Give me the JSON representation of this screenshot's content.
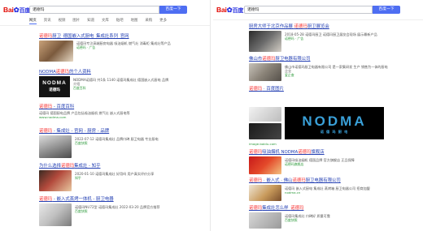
{
  "left": {
    "logo_b": "Bai",
    "logo_du": "百度",
    "query": "诺德玛",
    "search_button": "百度一下",
    "tabs": [
      "网页",
      "资讯",
      "视频",
      "图片",
      "知道",
      "文库",
      "贴吧",
      "地图",
      "采购",
      "更多"
    ],
    "results": [
      {
        "title": "诺德玛厨卫_德国嵌入式厨电_集成灶系列_官网",
        "snippet": "诺德玛专注高端厨房电器 吸油烟机 燃气灶 消毒柜 集成灶等产品",
        "meta": "诺德玛 · 广告"
      },
      {
        "title": "NODMA诺德玛的个人资料",
        "snippet": "NODMA诺德玛 共1条 1140 诺德玛集成灶 德国嵌入式厨电 品牌介绍",
        "meta": "百度百科"
      },
      {
        "title": "诺德玛 - 百度百科",
        "snippet": "诺德玛 德国厨电品牌 产品包括吸油烟机 燃气灶 嵌入式厨电等",
        "meta": "www.nodma.com"
      },
      {
        "title": "诺德玛 - 集成灶 - 官网 - 厨房 - 品牌",
        "snippet": "2022-07-12 诺德玛集成灶 品牌口碑 厨卫电器 专业厨电",
        "meta": "百度快照"
      },
      {
        "title": "为什么选择诺德玛集成灶 - 知乎",
        "snippet": "2020-01-10 诺德玛集成灶 好用吗 用户真实评价分享",
        "meta": "知乎"
      },
      {
        "title": "诺德玛 - 嵌入式蒸烤一体机 - 厨卫电器",
        "snippet": "诺德玛NU72型 诺德玛集成灶 2022-03-20 品牌官方推荐",
        "meta": "百度快照"
      }
    ],
    "nodma_logo": "NODMA",
    "nodma_sub": "诺德玛"
  },
  "right": {
    "logo_b": "Bai",
    "logo_du": "百度",
    "query": "诺德玛",
    "search_button": "百度一下",
    "results": [
      {
        "title": "厨房大师于北京作品展 诺德玛厨卫展览会",
        "snippet": "2018-05-28 诺德玛厨卫 诺德玛厨卫展览会现场 展示最新产品",
        "meta": "诺德玛 · 广告"
      },
      {
        "title": "佛山市诺德玛厨卫电器有限公司",
        "snippet": "佛山市诺德玛厨卫电器有限公司 是一家集研发 生产 销售为一体的厨电企业",
        "meta": "爱企查"
      },
      {
        "title": "诺德玛 · 百度图片",
        "snippet": "",
        "meta": "image.baidu.com"
      },
      {
        "title": "诺德玛吸油烟机 NODMA诺德玛旗舰店",
        "snippet": "诺德玛吸油烟机 德国品牌 官方旗舰店 正品保障",
        "meta": "诺德玛旗舰店"
      },
      {
        "title": "诺德玛 · 嵌入式 · 佛山诺德玛厨卫电器有限公司",
        "snippet": "诺德玛 嵌入式厨电 集成灶 蒸烤箱 厨卫电器公司 招商加盟",
        "meta": "nodma.cn"
      },
      {
        "title": "诺德玛集成灶怎么样_诺德玛",
        "snippet": "诺德玛集成灶 口碑好 质量可靠",
        "meta": "百度快照"
      }
    ],
    "nodma_logo": "NODMA",
    "nodma_sub": "诺 德 玛 厨 电"
  },
  "colors": {
    "accent": "#4e6ef2",
    "link": "#2440b3",
    "highlight": "#f73131",
    "url_green": "#2b9939",
    "logo_red": "#e10601",
    "logo_blue": "#2932e1"
  },
  "icons": [
    "paw-icon"
  ]
}
